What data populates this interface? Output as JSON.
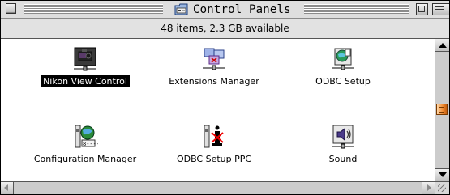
{
  "window": {
    "title": "Control Panels",
    "status": "48 items, 2.3 GB available"
  },
  "items": [
    {
      "label": "Nikon View Control",
      "icon": "nikon-camera-icon",
      "selected": true
    },
    {
      "label": "Extensions Manager",
      "icon": "extensions-manager-icon",
      "selected": false
    },
    {
      "label": "ODBC Setup",
      "icon": "odbc-setup-icon",
      "selected": false
    },
    {
      "label": "Configuration Manager",
      "icon": "configuration-manager-icon",
      "selected": false
    },
    {
      "label": "ODBC Setup PPC",
      "icon": "odbc-setup-ppc-icon",
      "selected": false
    },
    {
      "label": "Sound",
      "icon": "speaker-icon",
      "selected": false
    }
  ],
  "colors": {
    "selection_bg": "#000000",
    "scroll_thumb": "#f08a30",
    "window_chrome": "#dddddd"
  }
}
